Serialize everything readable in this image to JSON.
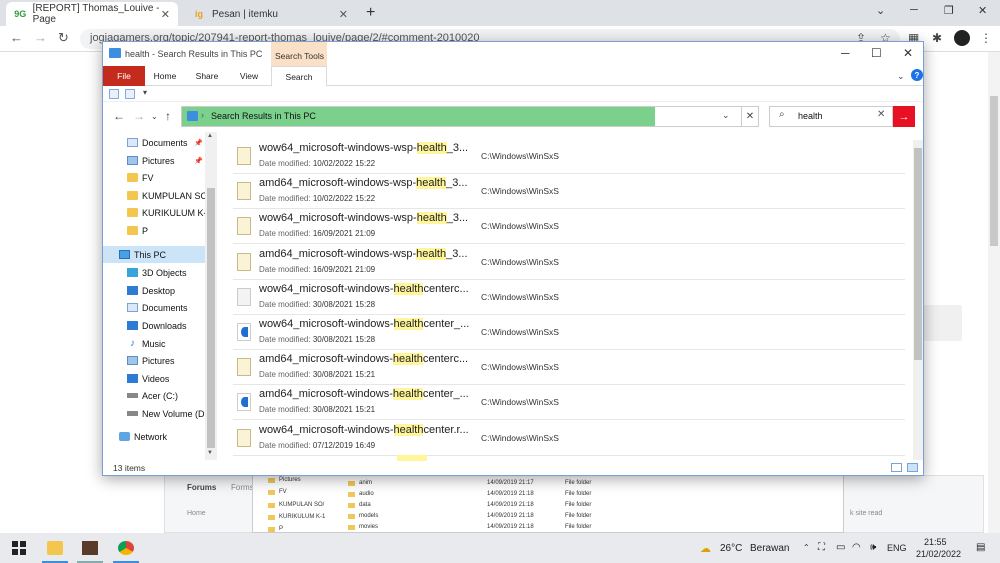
{
  "browser": {
    "tabs": [
      {
        "favicon": "9G",
        "title": "[REPORT] Thomas_Louive - Page"
      },
      {
        "favicon": "ig",
        "title": "Pesan | itemku"
      }
    ],
    "url": "jogjagamers.org/topic/207941-report-thomas_louive/page/2/#comment-2010020"
  },
  "background_page": {
    "forums_label": "Forums",
    "forums_label_2": "Forms",
    "home_label": "Home",
    "read_label": "k site read",
    "bg_nav_items": [
      "Pictures",
      "FV",
      "KUMPULAN SO/",
      "KURIKULUM K-1",
      "P"
    ],
    "bg_rows": [
      {
        "name": "anim",
        "date": "14/09/2019 21:17",
        "type": "File folder"
      },
      {
        "name": "audio",
        "date": "14/09/2019 21:18",
        "type": "File folder"
      },
      {
        "name": "data",
        "date": "14/09/2019 21:18",
        "type": "File folder"
      },
      {
        "name": "models",
        "date": "14/09/2019 21:18",
        "type": "File folder"
      },
      {
        "name": "movies",
        "date": "14/09/2019 21:18",
        "type": "File folder"
      }
    ]
  },
  "explorer": {
    "title": "health - Search Results in This PC",
    "search_tools_label": "Search Tools",
    "ribbon_tabs": [
      "File",
      "Home",
      "Share",
      "View",
      "Search"
    ],
    "address": "Search Results in This PC",
    "search_value": "health",
    "nav_items": [
      {
        "label": "Documents",
        "icon": "doc",
        "pinned": true
      },
      {
        "label": "Pictures",
        "icon": "pic",
        "pinned": true
      },
      {
        "label": "FV",
        "icon": "folder"
      },
      {
        "label": "KUMPULAN SOAL",
        "icon": "folder"
      },
      {
        "label": "KURIKULUM K-13",
        "icon": "folder"
      },
      {
        "label": "P",
        "icon": "folder"
      },
      {
        "label": "This PC",
        "icon": "pc",
        "selected": true
      },
      {
        "label": "3D Objects",
        "icon": "cube"
      },
      {
        "label": "Desktop",
        "icon": "blue"
      },
      {
        "label": "Documents",
        "icon": "doc"
      },
      {
        "label": "Downloads",
        "icon": "blue"
      },
      {
        "label": "Music",
        "icon": "music"
      },
      {
        "label": "Pictures",
        "icon": "pic"
      },
      {
        "label": "Videos",
        "icon": "blue"
      },
      {
        "label": "Acer (C:)",
        "icon": "disk"
      },
      {
        "label": "New Volume (D:)",
        "icon": "disk"
      },
      {
        "label": "Network",
        "icon": "net"
      }
    ],
    "date_label": "Date modified:",
    "results": [
      {
        "pre": "wow64_microsoft-windows-wsp-",
        "hit": "health",
        "post": "_3...",
        "date": "10/02/2022 15:22",
        "path": "C:\\Windows\\WinSxS",
        "icon": "folder"
      },
      {
        "pre": "amd64_microsoft-windows-wsp-",
        "hit": "health",
        "post": "_3...",
        "date": "10/02/2022 15:22",
        "path": "C:\\Windows\\WinSxS",
        "icon": "folder"
      },
      {
        "pre": "wow64_microsoft-windows-wsp-",
        "hit": "health",
        "post": "_3...",
        "date": "16/09/2021 21:09",
        "path": "C:\\Windows\\WinSxS",
        "icon": "folder"
      },
      {
        "pre": "amd64_microsoft-windows-wsp-",
        "hit": "health",
        "post": "_3...",
        "date": "16/09/2021 21:09",
        "path": "C:\\Windows\\WinSxS",
        "icon": "folder"
      },
      {
        "pre": "wow64_microsoft-windows-",
        "hit": "health",
        "post": "centerc...",
        "date": "30/08/2021 15:28",
        "path": "C:\\Windows\\WinSxS",
        "icon": "gear"
      },
      {
        "pre": "wow64_microsoft-windows-",
        "hit": "health",
        "post": "center_...",
        "date": "30/08/2021 15:28",
        "path": "C:\\Windows\\WinSxS",
        "icon": "media"
      },
      {
        "pre": "amd64_microsoft-windows-",
        "hit": "health",
        "post": "centerc...",
        "date": "30/08/2021 15:21",
        "path": "C:\\Windows\\WinSxS",
        "icon": "folder"
      },
      {
        "pre": "amd64_microsoft-windows-",
        "hit": "health",
        "post": "center_...",
        "date": "30/08/2021 15:21",
        "path": "C:\\Windows\\WinSxS",
        "icon": "media"
      },
      {
        "pre": "wow64_microsoft-windows-",
        "hit": "health",
        "post": "center.r...",
        "date": "07/12/2019 16:49",
        "path": "C:\\Windows\\WinSxS",
        "icon": "folder"
      }
    ],
    "status_count": "13 items"
  },
  "taskbar": {
    "weather_temp": "26°C",
    "weather_text": "Berawan",
    "language": "ENG",
    "time": "21:55",
    "date": "21/02/2022"
  },
  "colors": {
    "file_tab": "#c42b1c",
    "search_tools": "#fbe0c8",
    "address_highlight": "#7bd08c",
    "search_go": "#e81123",
    "match_highlight": "#fff59a"
  }
}
